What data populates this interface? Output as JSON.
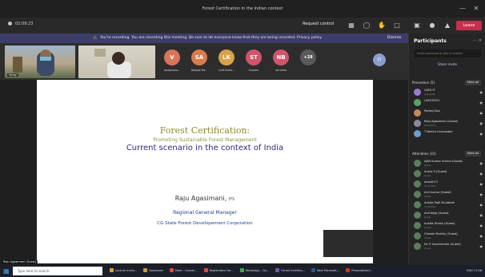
{
  "window": {
    "title": "Forest Certification in the Indian context"
  },
  "toolbar": {
    "timer": "02:09:23",
    "request_control": "Request control",
    "leave_label": "Leave"
  },
  "banner": {
    "text": "You're recording. You are recording this meeting. Be sure to let everyone know that they are being recorded. Privacy policy",
    "dismiss": "Dismiss"
  },
  "video_tiles": [
    {
      "name": "Vinay"
    },
    {
      "name": ""
    }
  ],
  "avatars": [
    {
      "initials": "V",
      "label": "vinaykuma...",
      "color": "#d9745a"
    },
    {
      "initials": "SA",
      "label": "Deepak Ra...",
      "color": "#d97b4a"
    },
    {
      "initials": "LK",
      "label": "Lalit Kuma...",
      "color": "#d9a24a"
    },
    {
      "initials": "ST",
      "label": "Surnam",
      "color": "#d2546a"
    },
    {
      "initials": "NB",
      "label": "nb kuma",
      "color": "#d2546a"
    },
    {
      "initials": "+28",
      "label": "",
      "color": "#5a5a5a"
    }
  ],
  "slide": {
    "title": "Forest Certification:",
    "subtitle": "Promoting Sustainable Forest Management",
    "main": "Current scenario in the context of India",
    "presenter_name": "Raju Agasimani",
    "presenter_suffix": "IFS",
    "role": "Regional General Manager",
    "org": "CG State Forest Developement Corporation",
    "presenter_label": "Raju Agasimani (Guest)"
  },
  "panel": {
    "title": "Participants",
    "invite_placeholder": "Invite someone or dial a number",
    "share_invite": "Share invite",
    "presenters_label": "Presenters (5)",
    "mute_all": "Mute all",
    "attendees_label": "Attendees (31)",
    "mute_all_2": "Mute all",
    "presenters": [
      {
        "name": "CAFS IT",
        "sub": "Organizer"
      },
      {
        "name": "CAFSTECH",
        "sub": ""
      },
      {
        "name": "Pankaj Das",
        "sub": ""
      },
      {
        "name": "Raju Agasimani (Guest)",
        "sub": "Presenting"
      },
      {
        "name": "T Neelur Licensable",
        "sub": ""
      }
    ],
    "attendees": [
      {
        "name": "Ajith Kumar Arvind (Guest)",
        "sub": "Guest"
      },
      {
        "name": "Ankur S (Guest)",
        "sub": "Guest"
      },
      {
        "name": "ananth71",
        "sub": "Unverified"
      },
      {
        "name": "Anil kumar (Guest)",
        "sub": "Guest"
      },
      {
        "name": "Ankita Patil Mulukhet",
        "sub": "Unverified"
      },
      {
        "name": "Anil Negi (Guest)",
        "sub": "Guest"
      },
      {
        "name": "Ankita Ghosh (Guest)",
        "sub": "Guest"
      },
      {
        "name": "Chesah Murthy (Guest)",
        "sub": "Guest"
      },
      {
        "name": "Dr. P. Kanchimohi (Guest)",
        "sub": "Guest"
      }
    ]
  },
  "taskbar": {
    "search_placeholder": "Type here to search",
    "apps": [
      {
        "label": "Lecture Invita...",
        "color": "#d9a23a"
      },
      {
        "label": "Download",
        "color": "#c9a03a"
      },
      {
        "label": "Meet - Commi...",
        "color": "#e04a3a"
      },
      {
        "label": "Registration for...",
        "color": "#e04a3a"
      },
      {
        "label": "WhatsApp - Go...",
        "color": "#38b24a"
      },
      {
        "label": "Forest Certifica...",
        "color": "#6264a7"
      },
      {
        "label": "New Microsoft...",
        "color": "#2b579a"
      },
      {
        "label": "Presentation1 -",
        "color": "#c43e1c"
      }
    ],
    "tray": "ENG 11:08"
  }
}
